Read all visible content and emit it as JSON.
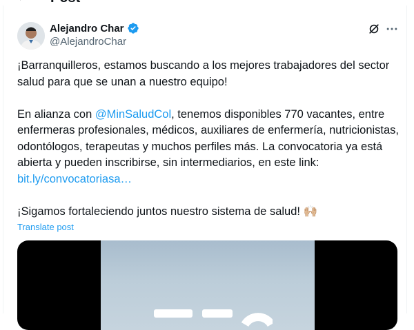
{
  "header": {
    "title": "Post",
    "back_glyph": "←"
  },
  "author": {
    "name": "Alejandro Char",
    "handle": "@AlejandroChar",
    "verified": true
  },
  "post": {
    "p1": "¡Barranquilleros, estamos buscando a los mejores trabajadores del sector salud para que se unan a nuestro equipo!",
    "p2_pre": "En alianza con ",
    "p2_mention": "@MinSaludCol",
    "p2_post": ", tenemos disponibles 770 vacantes, entre enfermeras profesionales, médicos, auxiliares de enfermería, nutricionistas, odontólogos, terapeutas y muchos perfiles más. La convocatoria ya está abierta y pueden inscribirse, sin intermediarios, en este link: ",
    "p2_link": "bit.ly/convocatoriasa…",
    "p3": "¡Sigamos fortaleciendo juntos nuestro sistema de salud! 🙌🏼",
    "translate": "Translate post"
  },
  "icons": {
    "verified": "verified-badge-icon",
    "grok": "grok-icon",
    "more": "more-icon"
  },
  "colors": {
    "link": "#1d9bf0",
    "text": "#0f1419",
    "muted": "#536471"
  }
}
